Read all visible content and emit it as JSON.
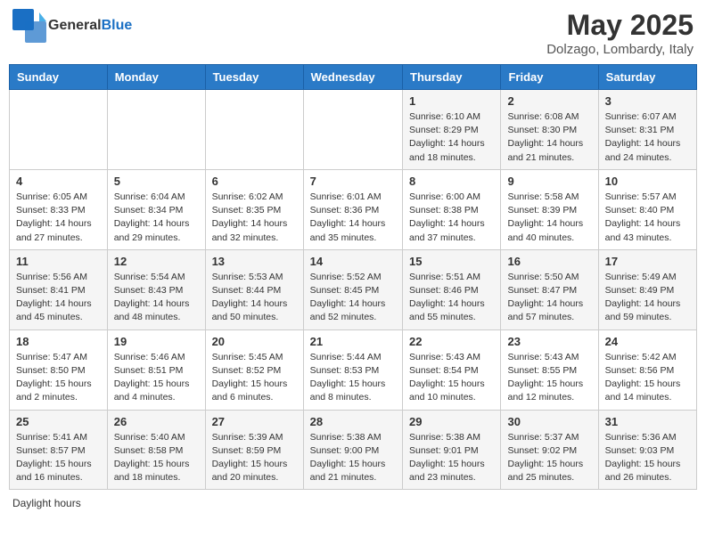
{
  "header": {
    "logo_line1": "General",
    "logo_line2": "Blue",
    "title": "May 2025",
    "subtitle": "Dolzago, Lombardy, Italy"
  },
  "weekdays": [
    "Sunday",
    "Monday",
    "Tuesday",
    "Wednesday",
    "Thursday",
    "Friday",
    "Saturday"
  ],
  "legend": {
    "label": "Daylight hours"
  },
  "weeks": [
    {
      "days": [
        {
          "num": "",
          "info": ""
        },
        {
          "num": "",
          "info": ""
        },
        {
          "num": "",
          "info": ""
        },
        {
          "num": "",
          "info": ""
        },
        {
          "num": "1",
          "info": "Sunrise: 6:10 AM\nSunset: 8:29 PM\nDaylight: 14 hours and 18 minutes."
        },
        {
          "num": "2",
          "info": "Sunrise: 6:08 AM\nSunset: 8:30 PM\nDaylight: 14 hours and 21 minutes."
        },
        {
          "num": "3",
          "info": "Sunrise: 6:07 AM\nSunset: 8:31 PM\nDaylight: 14 hours and 24 minutes."
        }
      ]
    },
    {
      "days": [
        {
          "num": "4",
          "info": "Sunrise: 6:05 AM\nSunset: 8:33 PM\nDaylight: 14 hours and 27 minutes."
        },
        {
          "num": "5",
          "info": "Sunrise: 6:04 AM\nSunset: 8:34 PM\nDaylight: 14 hours and 29 minutes."
        },
        {
          "num": "6",
          "info": "Sunrise: 6:02 AM\nSunset: 8:35 PM\nDaylight: 14 hours and 32 minutes."
        },
        {
          "num": "7",
          "info": "Sunrise: 6:01 AM\nSunset: 8:36 PM\nDaylight: 14 hours and 35 minutes."
        },
        {
          "num": "8",
          "info": "Sunrise: 6:00 AM\nSunset: 8:38 PM\nDaylight: 14 hours and 37 minutes."
        },
        {
          "num": "9",
          "info": "Sunrise: 5:58 AM\nSunset: 8:39 PM\nDaylight: 14 hours and 40 minutes."
        },
        {
          "num": "10",
          "info": "Sunrise: 5:57 AM\nSunset: 8:40 PM\nDaylight: 14 hours and 43 minutes."
        }
      ]
    },
    {
      "days": [
        {
          "num": "11",
          "info": "Sunrise: 5:56 AM\nSunset: 8:41 PM\nDaylight: 14 hours and 45 minutes."
        },
        {
          "num": "12",
          "info": "Sunrise: 5:54 AM\nSunset: 8:43 PM\nDaylight: 14 hours and 48 minutes."
        },
        {
          "num": "13",
          "info": "Sunrise: 5:53 AM\nSunset: 8:44 PM\nDaylight: 14 hours and 50 minutes."
        },
        {
          "num": "14",
          "info": "Sunrise: 5:52 AM\nSunset: 8:45 PM\nDaylight: 14 hours and 52 minutes."
        },
        {
          "num": "15",
          "info": "Sunrise: 5:51 AM\nSunset: 8:46 PM\nDaylight: 14 hours and 55 minutes."
        },
        {
          "num": "16",
          "info": "Sunrise: 5:50 AM\nSunset: 8:47 PM\nDaylight: 14 hours and 57 minutes."
        },
        {
          "num": "17",
          "info": "Sunrise: 5:49 AM\nSunset: 8:49 PM\nDaylight: 14 hours and 59 minutes."
        }
      ]
    },
    {
      "days": [
        {
          "num": "18",
          "info": "Sunrise: 5:47 AM\nSunset: 8:50 PM\nDaylight: 15 hours and 2 minutes."
        },
        {
          "num": "19",
          "info": "Sunrise: 5:46 AM\nSunset: 8:51 PM\nDaylight: 15 hours and 4 minutes."
        },
        {
          "num": "20",
          "info": "Sunrise: 5:45 AM\nSunset: 8:52 PM\nDaylight: 15 hours and 6 minutes."
        },
        {
          "num": "21",
          "info": "Sunrise: 5:44 AM\nSunset: 8:53 PM\nDaylight: 15 hours and 8 minutes."
        },
        {
          "num": "22",
          "info": "Sunrise: 5:43 AM\nSunset: 8:54 PM\nDaylight: 15 hours and 10 minutes."
        },
        {
          "num": "23",
          "info": "Sunrise: 5:43 AM\nSunset: 8:55 PM\nDaylight: 15 hours and 12 minutes."
        },
        {
          "num": "24",
          "info": "Sunrise: 5:42 AM\nSunset: 8:56 PM\nDaylight: 15 hours and 14 minutes."
        }
      ]
    },
    {
      "days": [
        {
          "num": "25",
          "info": "Sunrise: 5:41 AM\nSunset: 8:57 PM\nDaylight: 15 hours and 16 minutes."
        },
        {
          "num": "26",
          "info": "Sunrise: 5:40 AM\nSunset: 8:58 PM\nDaylight: 15 hours and 18 minutes."
        },
        {
          "num": "27",
          "info": "Sunrise: 5:39 AM\nSunset: 8:59 PM\nDaylight: 15 hours and 20 minutes."
        },
        {
          "num": "28",
          "info": "Sunrise: 5:38 AM\nSunset: 9:00 PM\nDaylight: 15 hours and 21 minutes."
        },
        {
          "num": "29",
          "info": "Sunrise: 5:38 AM\nSunset: 9:01 PM\nDaylight: 15 hours and 23 minutes."
        },
        {
          "num": "30",
          "info": "Sunrise: 5:37 AM\nSunset: 9:02 PM\nDaylight: 15 hours and 25 minutes."
        },
        {
          "num": "31",
          "info": "Sunrise: 5:36 AM\nSunset: 9:03 PM\nDaylight: 15 hours and 26 minutes."
        }
      ]
    }
  ]
}
